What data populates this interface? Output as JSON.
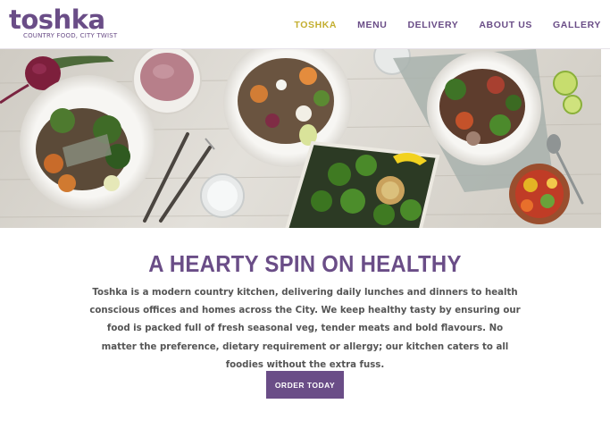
{
  "brand": {
    "logo_text": "toshka",
    "tagline": "COUNTRY FOOD, CITY TWIST",
    "primary_color": "#6a4d87",
    "accent_color": "#c3ae2f"
  },
  "nav": {
    "items": [
      {
        "label": "TOSHKA",
        "active": true
      },
      {
        "label": "MENU",
        "active": false
      },
      {
        "label": "DELIVERY",
        "active": false
      },
      {
        "label": "ABOUT US",
        "active": false
      },
      {
        "label": "GALLERY",
        "active": false
      }
    ]
  },
  "hero": {
    "image_subject": "overhead photo of healthy dishes on a wooden table"
  },
  "main": {
    "headline": "A HEARTY SPIN ON HEALTHY",
    "body": "Toshka is a modern country kitchen, delivering daily lunches and dinners to health conscious offices and homes across the City. We keep healthy tasty by ensuring our food is packed full of fresh seasonal veg, tender meats and bold flavours. No matter the preference, dietary requirement or allergy; our kitchen caters to all foodies without the extra fuss.",
    "cta_label": "ORDER TODAY"
  }
}
